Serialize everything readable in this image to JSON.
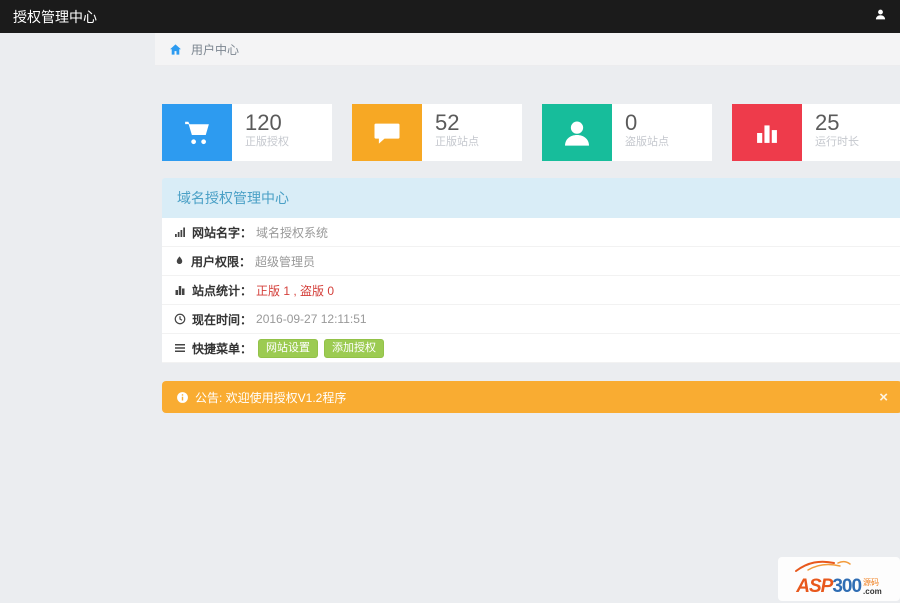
{
  "navbar": {
    "title": "授权管理中心"
  },
  "breadcrumb": {
    "current": "用户中心"
  },
  "stats": [
    {
      "value": "120",
      "label": "正版授权",
      "icon": "cart-icon",
      "color": "#2d9bf0"
    },
    {
      "value": "52",
      "label": "正版站点",
      "icon": "comment-icon",
      "color": "#f7a824"
    },
    {
      "value": "0",
      "label": "盗版站点",
      "icon": "user-icon",
      "color": "#17bd9b"
    },
    {
      "value": "25",
      "label": "运行时长",
      "icon": "bar-chart-icon",
      "color": "#ee3b4b"
    }
  ],
  "panel": {
    "title": "域名授权管理中心",
    "rows": [
      {
        "icon": "signal-icon",
        "label": "网站名字：",
        "value": "域名授权系统"
      },
      {
        "icon": "tint-icon",
        "label": "用户权限：",
        "value": "超级管理员"
      },
      {
        "icon": "bar-chart-icon",
        "label": "站点统计：",
        "value": "正版 1 , 盗版 0",
        "value_color": "#d43f3a"
      },
      {
        "icon": "clock-icon",
        "label": "现在时间：",
        "value": "2016-09-27 12:11:51"
      },
      {
        "icon": "list-icon",
        "label": "快捷菜单：",
        "buttons": [
          "网站设置",
          "添加授权"
        ]
      }
    ]
  },
  "alert": {
    "icon": "info-icon",
    "text": "公告: 欢迎使用授权V1.2程序",
    "close": "×",
    "color": "#f9ac32"
  },
  "logo": {
    "asp": "ASP",
    "num": "300",
    "suffix": "源码",
    "domain": ".com"
  },
  "colors": {
    "navbar_bg": "#1b1b1b",
    "page_bg": "#ebedf0",
    "breadcrumb_bg": "#f4f4f5",
    "panel_heading_bg": "#d9edf7",
    "panel_heading_text": "#4aa0c6",
    "green_button": "#9ccb52",
    "stats_red_text": "#d43f3a"
  }
}
